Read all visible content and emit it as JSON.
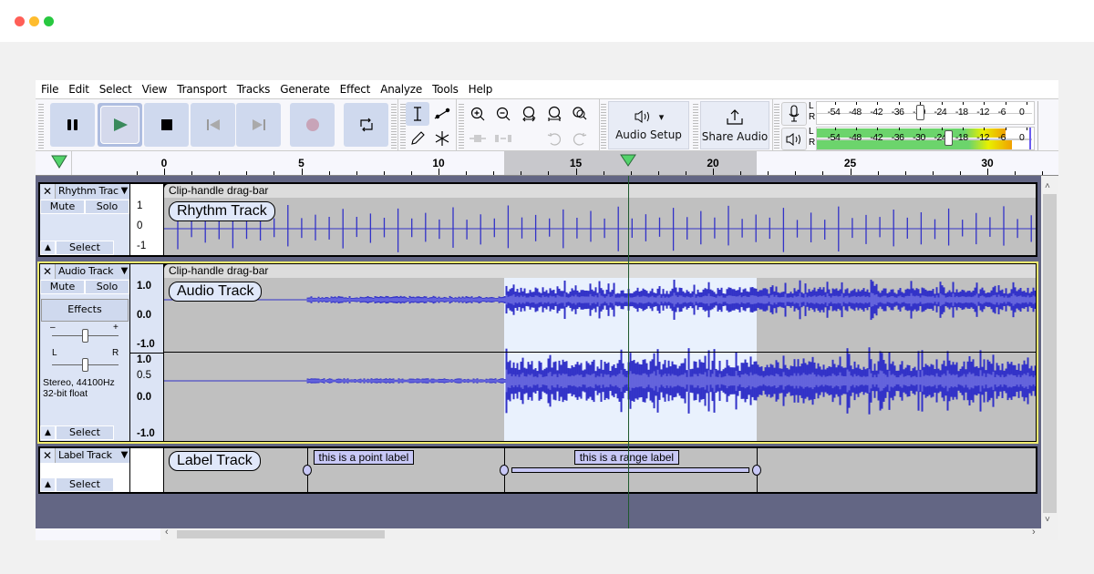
{
  "window": {
    "controls": [
      "close",
      "minimize",
      "maximize"
    ]
  },
  "menu": [
    "File",
    "Edit",
    "Select",
    "View",
    "Transport",
    "Tracks",
    "Generate",
    "Effect",
    "Analyze",
    "Tools",
    "Help"
  ],
  "transport": {
    "pause_icon": "pause-icon",
    "play_icon": "play-icon",
    "stop_icon": "stop-icon",
    "skip_start_icon": "skip-to-start-icon",
    "skip_end_icon": "skip-to-end-icon",
    "record_icon": "record-icon",
    "loop_icon": "loop-icon"
  },
  "tools": {
    "selection": "selection-tool",
    "envelope": "envelope-tool",
    "draw": "draw-tool",
    "multi": "multi-tool"
  },
  "audio_setup": {
    "label": "Audio Setup",
    "dropdown": "▾"
  },
  "share_audio": {
    "label": "Share Audio"
  },
  "meters": {
    "record_scale": [
      "-54",
      "-48",
      "-42",
      "-36",
      "-30",
      "-24",
      "-18",
      "-12",
      "-6",
      "0"
    ],
    "play_scale": [
      "-54",
      "-48",
      "-42",
      "-36",
      "-30",
      "-24",
      "-18",
      "-12",
      "-6",
      "0"
    ],
    "L": "L",
    "R": "R",
    "record_slider_db": -30,
    "play_slider_db": -22,
    "play_level_left_db": -6,
    "play_level_right_db": -4
  },
  "ruler": {
    "labels": [
      "0",
      "5",
      "10",
      "15",
      "20",
      "25",
      "30"
    ],
    "selection_start_s": 12.4,
    "selection_end_s": 21.6,
    "playhead_s": 16.9
  },
  "tracks": {
    "rhythm": {
      "name": "Rhythm Trac",
      "mute": "Mute",
      "solo": "Solo",
      "select": "Select",
      "clip_title": "Clip-handle drag-bar",
      "pill": "Rhythm Track",
      "scale": [
        "1",
        "0",
        "-1"
      ]
    },
    "audio": {
      "name": "Audio Track",
      "mute": "Mute",
      "solo": "Solo",
      "effects": "Effects",
      "gain_minus": "–",
      "gain_plus": "+",
      "pan_left": "L",
      "pan_right": "R",
      "info_line1": "Stereo, 44100Hz",
      "info_line2": "32-bit float",
      "select": "Select",
      "clip_title": "Clip-handle drag-bar",
      "pill": "Audio Track",
      "scale_top": [
        "1.0",
        "0.0",
        "-1.0"
      ],
      "scale_bottom": [
        "1.0",
        "0.5",
        "0.0",
        "-1.0"
      ]
    },
    "label": {
      "name": "Label Track",
      "select": "Select",
      "pill": "Label Track",
      "point_label": "this is a point label",
      "range_label": "this is a range label"
    }
  }
}
